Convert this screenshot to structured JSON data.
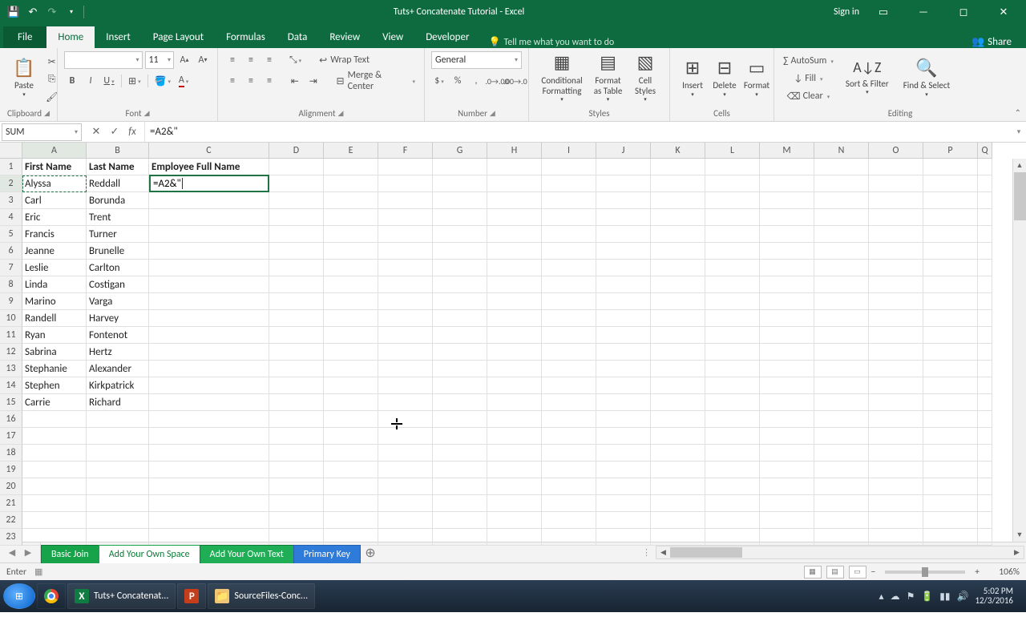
{
  "title": "Tuts+ Concatenate Tutorial - Excel",
  "signin": "Sign in",
  "ribbon_tabs": {
    "file": "File",
    "home": "Home",
    "insert": "Insert",
    "page_layout": "Page Layout",
    "formulas": "Formulas",
    "data": "Data",
    "review": "Review",
    "view": "View",
    "developer": "Developer"
  },
  "tellme": "Tell me what you want to do",
  "share": "Share",
  "groups": {
    "clipboard": "Clipboard",
    "font": "Font",
    "alignment": "Alignment",
    "number": "Number",
    "styles": "Styles",
    "cells": "Cells",
    "editing": "Editing"
  },
  "clipboard": {
    "paste": "Paste"
  },
  "font": {
    "name_value": "",
    "size": "11",
    "bold": "B",
    "italic": "I",
    "underline": "U"
  },
  "alignment": {
    "wrap": "Wrap Text",
    "merge": "Merge & Center"
  },
  "number": {
    "format": "General"
  },
  "styles": {
    "cond": "Conditional Formatting",
    "table": "Format as Table",
    "cell": "Cell Styles"
  },
  "cellsgrp": {
    "insert": "Insert",
    "delete": "Delete",
    "format": "Format"
  },
  "editing": {
    "autosum": "AutoSum",
    "fill": "Fill",
    "clear": "Clear",
    "sort": "Sort & Filter",
    "find": "Find & Select"
  },
  "namebox": "SUM",
  "formula": "=A2&\"",
  "edit_cell_text": "=A2&\"",
  "columns": [
    "A",
    "B",
    "C",
    "D",
    "E",
    "F",
    "G",
    "H",
    "I",
    "J",
    "K",
    "L",
    "M",
    "N",
    "O",
    "P",
    "Q"
  ],
  "col_classes": [
    "cA",
    "cB",
    "cC",
    "cD",
    "cE",
    "cF",
    "cG",
    "cH",
    "cI",
    "cJ",
    "cK",
    "cL",
    "cM",
    "cN",
    "cO",
    "cP",
    "cQ"
  ],
  "ref_cols": [
    "A"
  ],
  "ref_rows": [
    2
  ],
  "headers": {
    "A": "First Name",
    "B": "Last Name",
    "C": "Employee Full Name"
  },
  "rows": {
    "2": {
      "A": "Alyssa",
      "B": "Reddall"
    },
    "3": {
      "A": "Carl",
      "B": "Borunda"
    },
    "4": {
      "A": "Eric",
      "B": "Trent"
    },
    "5": {
      "A": "Francis",
      "B": "Turner"
    },
    "6": {
      "A": "Jeanne",
      "B": "Brunelle"
    },
    "7": {
      "A": "Leslie",
      "B": "Carlton"
    },
    "8": {
      "A": "Linda",
      "B": "Costigan"
    },
    "9": {
      "A": "Marino",
      "B": "Varga"
    },
    "10": {
      "A": "Randell",
      "B": "Harvey"
    },
    "11": {
      "A": "Ryan",
      "B": "Fontenot"
    },
    "12": {
      "A": "Sabrina",
      "B": "Hertz"
    },
    "13": {
      "A": "Stephanie",
      "B": "Alexander"
    },
    "14": {
      "A": "Stephen",
      "B": "Kirkpatrick"
    },
    "15": {
      "A": "Carrie",
      "B": "Richard"
    }
  },
  "total_rows": 23,
  "sheets": [
    {
      "name": "Basic Join",
      "cls": "green1"
    },
    {
      "name": "Add Your Own Space",
      "cls": "greentxt"
    },
    {
      "name": "Add Your Own Text",
      "cls": "green2"
    },
    {
      "name": "Primary Key",
      "cls": "blue"
    }
  ],
  "status": {
    "mode": "Enter",
    "zoom": "106%"
  },
  "taskbar": {
    "apps": [
      {
        "label": "Tuts+ Concatenat...",
        "icon": "X",
        "color": "#107c41"
      },
      {
        "label": "",
        "icon": "P",
        "color": "#c43e1c"
      },
      {
        "label": "SourceFiles-Conc...",
        "icon": "📁",
        "color": "#f0c674"
      }
    ],
    "time": "5:02 PM",
    "date": "12/3/2016"
  }
}
